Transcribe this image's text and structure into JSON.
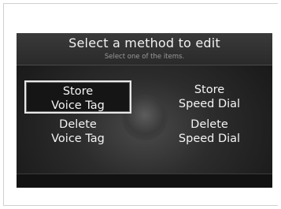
{
  "screen": {
    "title": "Select a method to edit",
    "subtitle": "Select one of the items."
  },
  "menu": {
    "items": [
      {
        "line1": "Store",
        "line2": "Voice Tag",
        "selected": true
      },
      {
        "line1": "Store",
        "line2": "Speed Dial",
        "selected": false
      },
      {
        "line1": "Delete",
        "line2": "Voice Tag",
        "selected": false
      },
      {
        "line1": "Delete",
        "line2": "Speed Dial",
        "selected": false
      }
    ]
  },
  "colors": {
    "background": "#1d1d1d",
    "text": "#f4f4f4",
    "subtitle": "#9a9a9a",
    "selection_border": "#e8e8e8"
  }
}
